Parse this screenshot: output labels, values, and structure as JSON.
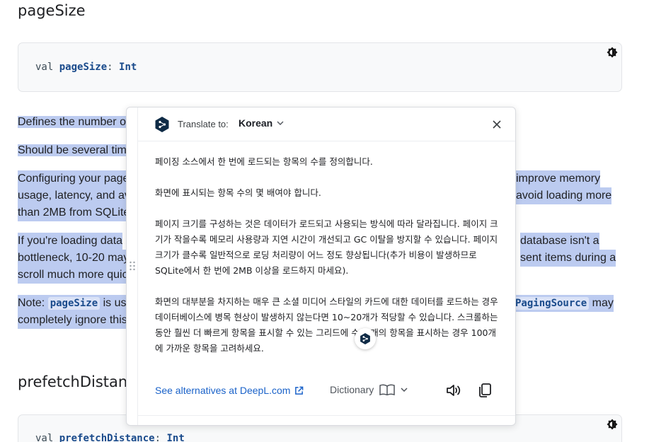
{
  "sections": {
    "page_size": {
      "heading": "pageSize",
      "code": {
        "kw": "val",
        "name": "pageSize",
        "colon": ":",
        "type": "Int"
      }
    },
    "prefetch": {
      "heading": "prefetchDistance",
      "code": {
        "kw": "val",
        "name": "prefetchDistance",
        "colon": ":",
        "type": "Int"
      }
    }
  },
  "paragraphs": {
    "p1": "Defines the number o",
    "p2": "Should be several tim",
    "p3_l1_left": "Configuring your page",
    "p3_l1_right": "improve memory",
    "p3_l2_left": "usage, latency, and av",
    "p3_l2_right": "avoid loading more",
    "p3_l3_left": "than 2MB from SQLite",
    "p4_l1_left": "If you're loading data",
    "p4_l1_right": "database isn't a",
    "p4_l2_left": "bottleneck, 10-20 may",
    "p4_l2_right": "sent items during a",
    "p4_l3_left": "scroll much more quic",
    "p5_label": "Note:",
    "p5_code": "pageSize",
    "p5_mid": "is us",
    "p5_code2": "PagingSource",
    "p5_end": "may",
    "p5_l2": "completely ignore this"
  },
  "popup": {
    "translate_to": "Translate to:",
    "language": "Korean",
    "translation": [
      "페이징 소스에서 한 번에 로드되는 항목의 수를 정의합니다.",
      "화면에 표시되는 항목 수의 몇 배여야 합니다.",
      "페이지 크기를 구성하는 것은 데이터가 로드되고 사용되는 방식에 따라 달라집니다. 페이지 크기가 작을수록 메모리 사용량과 지연 시간이 개선되고 GC 이탈을 방지할 수 있습니다. 페이지 크기가 클수록 일반적으로 로딩 처리량이 어느 정도 향상됩니다(추가 비용이 발생하므로 SQLite에서 한 번에 2MB 이상을 로드하지 마세요).",
      "화면의 대부분을 차지하는 매우 큰 소셜 미디어 스타일의 카드에 대한 데이터를 로드하는 경우 데이터베이스에 병목 현상이 발생하지 않는다면 10~20개가 적당할 수 있습니다. 스크롤하는 동안 훨씬 더 빠르게 항목을 표시할 수 있는 그리드에 수십 개의 항목을 표시하는 경우 100개에 가까운 항목을 고려하세요."
    ],
    "alternatives_link": "See alternatives at DeepL.com",
    "dictionary": "Dictionary"
  },
  "colors": {
    "highlight": "#bccbf0",
    "link": "#1a62c9",
    "deepl_brand": "#0f2b46"
  }
}
